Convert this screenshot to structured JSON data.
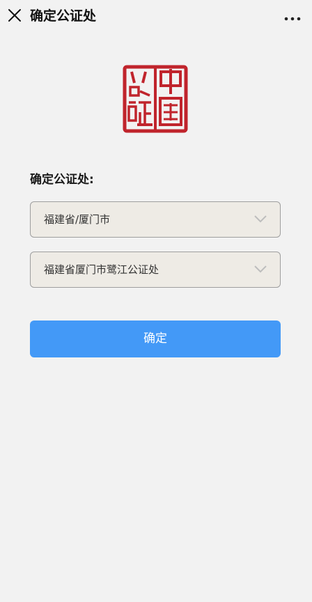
{
  "header": {
    "title": "确定公证处"
  },
  "logo": {
    "text": "中国公证"
  },
  "form": {
    "label": "确定公证处:",
    "region_select": {
      "value": "福建省/厦门市"
    },
    "office_select": {
      "value": "福建省厦门市鹭江公证处"
    },
    "confirm_label": "确定"
  },
  "colors": {
    "background": "#f2f2f2",
    "select_background": "#eeebe5",
    "button": "#4399f7",
    "seal_red": "#c0242c"
  },
  "icons": {
    "close": "close-icon",
    "more": "more-icon",
    "chevron": "chevron-down-icon"
  }
}
